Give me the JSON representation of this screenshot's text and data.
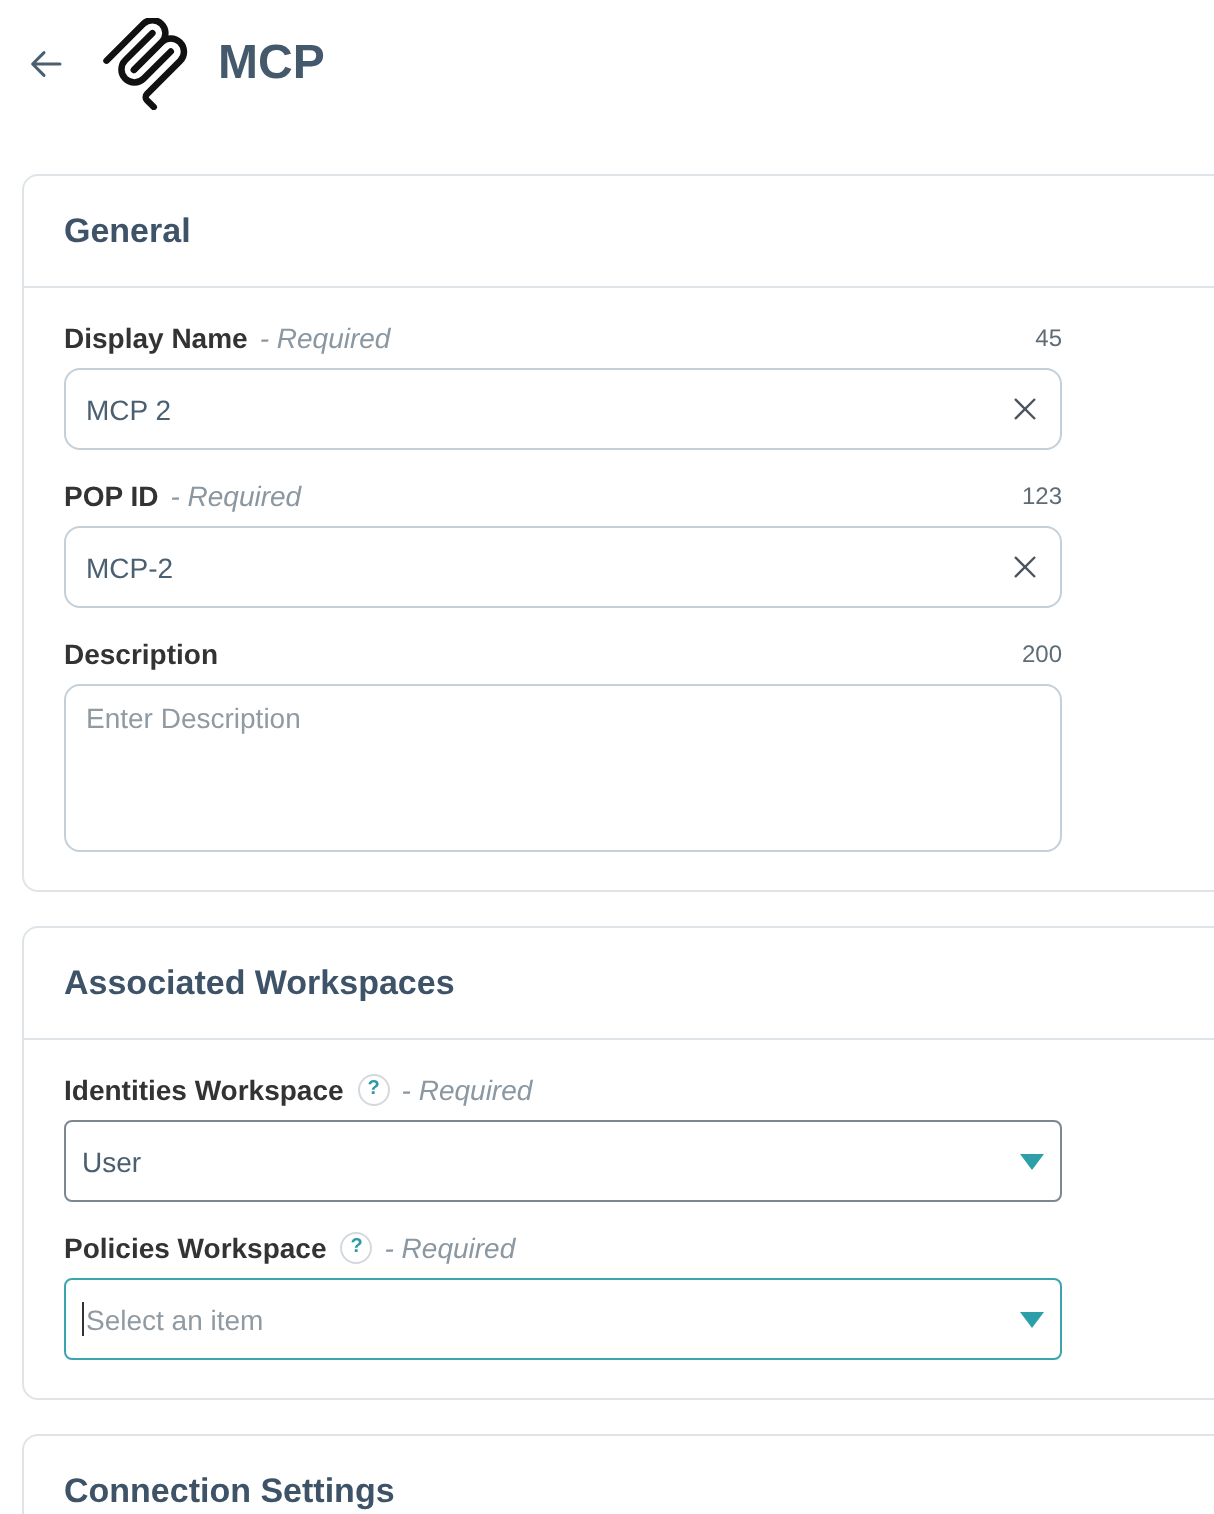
{
  "header": {
    "title": "MCP"
  },
  "sections": [
    {
      "title": "General",
      "fields": [
        {
          "kind": "text",
          "label": "Display Name",
          "required_note": "- Required",
          "counter": "45",
          "value": "MCP 2",
          "clearable": true
        },
        {
          "kind": "text",
          "label": "POP ID",
          "required_note": "- Required",
          "counter": "123",
          "value": "MCP-2",
          "clearable": true
        },
        {
          "kind": "textarea",
          "label": "Description",
          "counter": "200",
          "placeholder": "Enter Description"
        }
      ]
    },
    {
      "title": "Associated Workspaces",
      "fields": [
        {
          "kind": "select",
          "label": "Identities Workspace",
          "help": "?",
          "required_note": "- Required",
          "value": "User",
          "focused": false
        },
        {
          "kind": "select",
          "label": "Policies Workspace",
          "help": "?",
          "required_note": "- Required",
          "placeholder": "Select an item",
          "focused": true
        }
      ]
    },
    {
      "title": "Connection Settings"
    }
  ]
}
